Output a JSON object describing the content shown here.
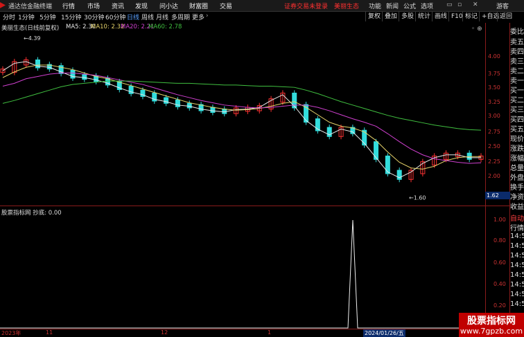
{
  "topbar": {
    "app_title": "通达信金融终端",
    "menus": [
      "行情",
      "市场",
      "资讯",
      "发现",
      "问小达",
      "财富圈",
      "交易"
    ],
    "notice": "证券交易未登录　美丽生态",
    "right_menus": [
      "功能",
      "新闻",
      "公式",
      "选项"
    ],
    "user": "游客"
  },
  "periods": [
    "分时",
    "1分钟",
    "5分钟",
    "15分钟",
    "30分钟",
    "60分钟",
    "日线",
    "周线",
    "月线",
    "多周期",
    "更多"
  ],
  "active_period": "日线",
  "toolbar": [
    "复权",
    "叠加",
    "多股",
    "统计",
    "画线",
    "F10",
    "标记",
    "+自选",
    "返回"
  ],
  "main_chart": {
    "title": "美丽生态(日线前复权)",
    "ma5": "MA5: 2.30",
    "ma10": "MA10: 2.32",
    "ma20": "MA20: 2.21",
    "ma60": "MA60: 2.78",
    "high_label": "4.39",
    "low_label": "1.60",
    "current_price": "1.62",
    "y_ticks": [
      "4.00",
      "3.75",
      "3.50",
      "3.25",
      "3.00",
      "2.75",
      "2.50",
      "2.25",
      "2.00"
    ]
  },
  "indicator": {
    "title": "股票指标网 抄底: 0.00",
    "y_ticks": [
      "1.00",
      "0.80",
      "0.60",
      "0.40",
      "0.20"
    ]
  },
  "x_axis": {
    "labels": [
      "2023年",
      "11",
      "12",
      "1"
    ],
    "highlight": "2024/01/26/五"
  },
  "right_panel": {
    "labels": [
      "委比",
      "卖五",
      "卖四",
      "卖三",
      "卖二",
      "卖一",
      "买一",
      "买二",
      "买三",
      "买四",
      "买五",
      "现价",
      "涨跌",
      "涨幅",
      "总量",
      "外盘",
      "换手",
      "净资",
      "收益"
    ],
    "auto_label": "自动",
    "quote_label": "行情",
    "times": [
      "14:5",
      "14:5",
      "14:5",
      "14:5",
      "14:5",
      "14:5",
      "14:5",
      "14:5"
    ]
  },
  "watermark": {
    "line1": "股票指标网",
    "line2": "www.7gpzb.com"
  },
  "colors": {
    "up": "#ff3333",
    "down": "#33dddd",
    "ma5": "#e8e8e8",
    "ma10": "#e6d36a",
    "ma20": "#d040d0",
    "ma60": "#40c040"
  },
  "chart_data": {
    "type": "line",
    "description_free": true,
    "series": [
      {
        "name": "MA5",
        "values": [
          3.82,
          3.95,
          3.98,
          3.9,
          3.88,
          3.8,
          3.72,
          3.7,
          3.66,
          3.6,
          3.52,
          3.45,
          3.4,
          3.32,
          3.28,
          3.22,
          3.2,
          3.15,
          3.12,
          3.1,
          3.14,
          3.15,
          3.18,
          3.3,
          3.4,
          3.2,
          2.95,
          2.8,
          2.7,
          2.8,
          2.75,
          2.55,
          2.3,
          2.05,
          1.95,
          2.05,
          2.2,
          2.3,
          2.35,
          2.35,
          2.3,
          2.3
        ]
      },
      {
        "name": "MA10",
        "values": [
          3.7,
          3.8,
          3.88,
          3.92,
          3.92,
          3.88,
          3.84,
          3.78,
          3.72,
          3.68,
          3.62,
          3.56,
          3.5,
          3.44,
          3.38,
          3.32,
          3.26,
          3.22,
          3.18,
          3.15,
          3.13,
          3.14,
          3.16,
          3.2,
          3.25,
          3.28,
          3.18,
          3.05,
          2.92,
          2.85,
          2.82,
          2.75,
          2.6,
          2.4,
          2.22,
          2.12,
          2.1,
          2.15,
          2.25,
          2.3,
          2.32,
          2.32
        ]
      },
      {
        "name": "MA20",
        "values": [
          3.55,
          3.6,
          3.68,
          3.72,
          3.76,
          3.78,
          3.78,
          3.76,
          3.74,
          3.7,
          3.66,
          3.62,
          3.58,
          3.52,
          3.46,
          3.4,
          3.35,
          3.3,
          3.26,
          3.22,
          3.2,
          3.18,
          3.17,
          3.18,
          3.2,
          3.22,
          3.22,
          3.18,
          3.12,
          3.05,
          2.98,
          2.92,
          2.85,
          2.72,
          2.58,
          2.45,
          2.35,
          2.28,
          2.25,
          2.22,
          2.2,
          2.21
        ]
      },
      {
        "name": "MA60",
        "values": [
          3.25,
          3.3,
          3.36,
          3.42,
          3.48,
          3.54,
          3.58,
          3.6,
          3.62,
          3.64,
          3.64,
          3.64,
          3.63,
          3.62,
          3.61,
          3.6,
          3.6,
          3.59,
          3.58,
          3.57,
          3.57,
          3.56,
          3.55,
          3.55,
          3.54,
          3.53,
          3.48,
          3.42,
          3.35,
          3.28,
          3.22,
          3.16,
          3.1,
          3.04,
          2.99,
          2.95,
          2.91,
          2.87,
          2.84,
          2.81,
          2.79,
          2.78
        ]
      }
    ],
    "indicator_series": {
      "name": "抄底",
      "values_note": "single spike at 1.00 near 2024/01/26"
    },
    "ylim": [
      1.5,
      4.5
    ]
  }
}
